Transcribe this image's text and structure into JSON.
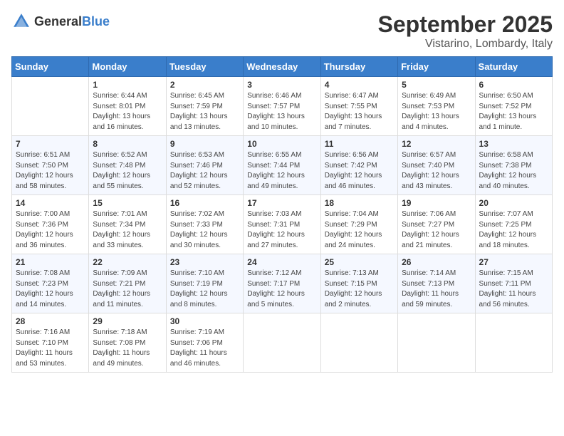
{
  "header": {
    "logo_general": "General",
    "logo_blue": "Blue",
    "month_title": "September 2025",
    "location": "Vistarino, Lombardy, Italy"
  },
  "days_of_week": [
    "Sunday",
    "Monday",
    "Tuesday",
    "Wednesday",
    "Thursday",
    "Friday",
    "Saturday"
  ],
  "weeks": [
    [
      {
        "day": "",
        "sunrise": "",
        "sunset": "",
        "daylight": ""
      },
      {
        "day": "1",
        "sunrise": "Sunrise: 6:44 AM",
        "sunset": "Sunset: 8:01 PM",
        "daylight": "Daylight: 13 hours and 16 minutes."
      },
      {
        "day": "2",
        "sunrise": "Sunrise: 6:45 AM",
        "sunset": "Sunset: 7:59 PM",
        "daylight": "Daylight: 13 hours and 13 minutes."
      },
      {
        "day": "3",
        "sunrise": "Sunrise: 6:46 AM",
        "sunset": "Sunset: 7:57 PM",
        "daylight": "Daylight: 13 hours and 10 minutes."
      },
      {
        "day": "4",
        "sunrise": "Sunrise: 6:47 AM",
        "sunset": "Sunset: 7:55 PM",
        "daylight": "Daylight: 13 hours and 7 minutes."
      },
      {
        "day": "5",
        "sunrise": "Sunrise: 6:49 AM",
        "sunset": "Sunset: 7:53 PM",
        "daylight": "Daylight: 13 hours and 4 minutes."
      },
      {
        "day": "6",
        "sunrise": "Sunrise: 6:50 AM",
        "sunset": "Sunset: 7:52 PM",
        "daylight": "Daylight: 13 hours and 1 minute."
      }
    ],
    [
      {
        "day": "7",
        "sunrise": "Sunrise: 6:51 AM",
        "sunset": "Sunset: 7:50 PM",
        "daylight": "Daylight: 12 hours and 58 minutes."
      },
      {
        "day": "8",
        "sunrise": "Sunrise: 6:52 AM",
        "sunset": "Sunset: 7:48 PM",
        "daylight": "Daylight: 12 hours and 55 minutes."
      },
      {
        "day": "9",
        "sunrise": "Sunrise: 6:53 AM",
        "sunset": "Sunset: 7:46 PM",
        "daylight": "Daylight: 12 hours and 52 minutes."
      },
      {
        "day": "10",
        "sunrise": "Sunrise: 6:55 AM",
        "sunset": "Sunset: 7:44 PM",
        "daylight": "Daylight: 12 hours and 49 minutes."
      },
      {
        "day": "11",
        "sunrise": "Sunrise: 6:56 AM",
        "sunset": "Sunset: 7:42 PM",
        "daylight": "Daylight: 12 hours and 46 minutes."
      },
      {
        "day": "12",
        "sunrise": "Sunrise: 6:57 AM",
        "sunset": "Sunset: 7:40 PM",
        "daylight": "Daylight: 12 hours and 43 minutes."
      },
      {
        "day": "13",
        "sunrise": "Sunrise: 6:58 AM",
        "sunset": "Sunset: 7:38 PM",
        "daylight": "Daylight: 12 hours and 40 minutes."
      }
    ],
    [
      {
        "day": "14",
        "sunrise": "Sunrise: 7:00 AM",
        "sunset": "Sunset: 7:36 PM",
        "daylight": "Daylight: 12 hours and 36 minutes."
      },
      {
        "day": "15",
        "sunrise": "Sunrise: 7:01 AM",
        "sunset": "Sunset: 7:34 PM",
        "daylight": "Daylight: 12 hours and 33 minutes."
      },
      {
        "day": "16",
        "sunrise": "Sunrise: 7:02 AM",
        "sunset": "Sunset: 7:33 PM",
        "daylight": "Daylight: 12 hours and 30 minutes."
      },
      {
        "day": "17",
        "sunrise": "Sunrise: 7:03 AM",
        "sunset": "Sunset: 7:31 PM",
        "daylight": "Daylight: 12 hours and 27 minutes."
      },
      {
        "day": "18",
        "sunrise": "Sunrise: 7:04 AM",
        "sunset": "Sunset: 7:29 PM",
        "daylight": "Daylight: 12 hours and 24 minutes."
      },
      {
        "day": "19",
        "sunrise": "Sunrise: 7:06 AM",
        "sunset": "Sunset: 7:27 PM",
        "daylight": "Daylight: 12 hours and 21 minutes."
      },
      {
        "day": "20",
        "sunrise": "Sunrise: 7:07 AM",
        "sunset": "Sunset: 7:25 PM",
        "daylight": "Daylight: 12 hours and 18 minutes."
      }
    ],
    [
      {
        "day": "21",
        "sunrise": "Sunrise: 7:08 AM",
        "sunset": "Sunset: 7:23 PM",
        "daylight": "Daylight: 12 hours and 14 minutes."
      },
      {
        "day": "22",
        "sunrise": "Sunrise: 7:09 AM",
        "sunset": "Sunset: 7:21 PM",
        "daylight": "Daylight: 12 hours and 11 minutes."
      },
      {
        "day": "23",
        "sunrise": "Sunrise: 7:10 AM",
        "sunset": "Sunset: 7:19 PM",
        "daylight": "Daylight: 12 hours and 8 minutes."
      },
      {
        "day": "24",
        "sunrise": "Sunrise: 7:12 AM",
        "sunset": "Sunset: 7:17 PM",
        "daylight": "Daylight: 12 hours and 5 minutes."
      },
      {
        "day": "25",
        "sunrise": "Sunrise: 7:13 AM",
        "sunset": "Sunset: 7:15 PM",
        "daylight": "Daylight: 12 hours and 2 minutes."
      },
      {
        "day": "26",
        "sunrise": "Sunrise: 7:14 AM",
        "sunset": "Sunset: 7:13 PM",
        "daylight": "Daylight: 11 hours and 59 minutes."
      },
      {
        "day": "27",
        "sunrise": "Sunrise: 7:15 AM",
        "sunset": "Sunset: 7:11 PM",
        "daylight": "Daylight: 11 hours and 56 minutes."
      }
    ],
    [
      {
        "day": "28",
        "sunrise": "Sunrise: 7:16 AM",
        "sunset": "Sunset: 7:10 PM",
        "daylight": "Daylight: 11 hours and 53 minutes."
      },
      {
        "day": "29",
        "sunrise": "Sunrise: 7:18 AM",
        "sunset": "Sunset: 7:08 PM",
        "daylight": "Daylight: 11 hours and 49 minutes."
      },
      {
        "day": "30",
        "sunrise": "Sunrise: 7:19 AM",
        "sunset": "Sunset: 7:06 PM",
        "daylight": "Daylight: 11 hours and 46 minutes."
      },
      {
        "day": "",
        "sunrise": "",
        "sunset": "",
        "daylight": ""
      },
      {
        "day": "",
        "sunrise": "",
        "sunset": "",
        "daylight": ""
      },
      {
        "day": "",
        "sunrise": "",
        "sunset": "",
        "daylight": ""
      },
      {
        "day": "",
        "sunrise": "",
        "sunset": "",
        "daylight": ""
      }
    ]
  ]
}
